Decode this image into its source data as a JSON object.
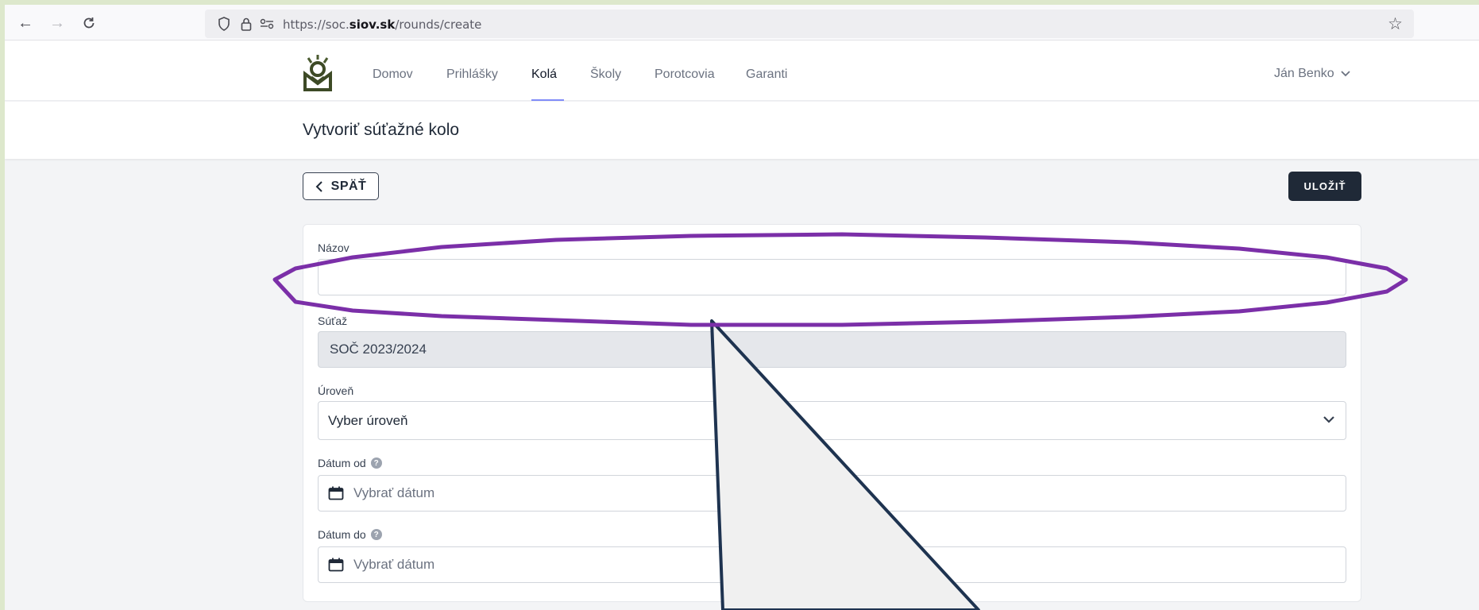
{
  "browser": {
    "url_prefix": "https://soc.",
    "url_domain": "siov.sk",
    "url_path": "/rounds/create"
  },
  "nav": {
    "items": [
      {
        "label": "Domov",
        "active": false
      },
      {
        "label": "Prihlášky",
        "active": false
      },
      {
        "label": "Kolá",
        "active": true
      },
      {
        "label": "Školy",
        "active": false
      },
      {
        "label": "Porotcovia",
        "active": false
      },
      {
        "label": "Garanti",
        "active": false
      }
    ],
    "user_name": "Ján Benko"
  },
  "page": {
    "title": "Vytvoriť súťažné kolo",
    "back_label": "SPÄŤ",
    "save_label": "ULOŽIŤ"
  },
  "form": {
    "nazov": {
      "label": "Názov",
      "value": ""
    },
    "sutaz": {
      "label": "Súťaž",
      "value": "SOČ 2023/2024"
    },
    "uroven": {
      "label": "Úroveň",
      "selected": "Vyber úroveň"
    },
    "datum_od": {
      "label": "Dátum od",
      "placeholder": "Vybrať dátum"
    },
    "datum_do": {
      "label": "Dátum do",
      "placeholder": "Vybrať dátum"
    }
  },
  "colors": {
    "annotation_ellipse": "#7b2fa8",
    "annotation_callout": "#1e3350",
    "primary_button": "#1f2937",
    "active_tab_underline": "#818cf8"
  }
}
